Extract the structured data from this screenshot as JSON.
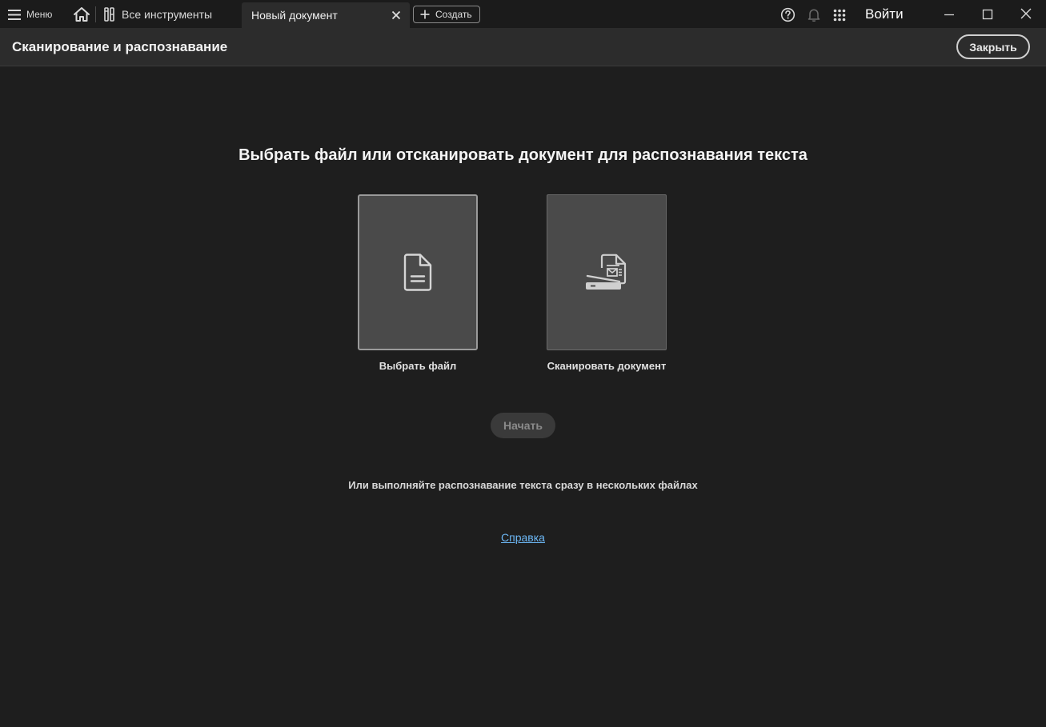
{
  "topbar": {
    "menu_label": "Меню",
    "tabs": [
      {
        "label": "Все инструменты"
      },
      {
        "label": "Новый документ",
        "active": true
      }
    ],
    "create_label": "Создать",
    "signin_label": "Войти"
  },
  "tool": {
    "title": "Сканирование и распознавание",
    "close_label": "Закрыть"
  },
  "main": {
    "heading": "Выбрать файл или отсканировать документ для распознавания текста",
    "options": [
      {
        "label": "Выбрать файл",
        "icon": "document-icon",
        "selected": true
      },
      {
        "label": "Сканировать документ",
        "icon": "scanner-icon",
        "selected": false
      }
    ],
    "start_label": "Начать",
    "batch_text": "Или выполняйте распознавание текста сразу в нескольких файлах",
    "help_link": "Справка"
  },
  "colors": {
    "background": "#1e1e1e",
    "toolbar": "#2c2c2c",
    "card": "#4a4a4a",
    "link": "#6cb7f5"
  }
}
